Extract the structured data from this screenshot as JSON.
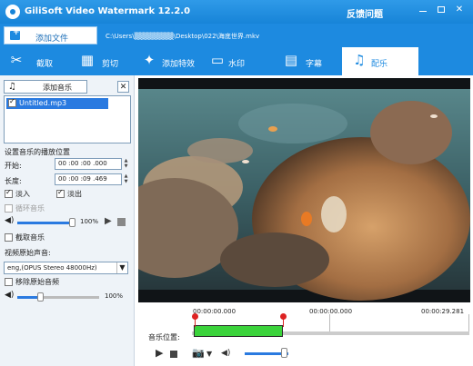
{
  "app": {
    "title": "GiliSoft Video Watermark 12.2.0",
    "feedback": "反馈问题"
  },
  "file": {
    "add_label": "添加文件",
    "path": "C:\\Users\\▒▒▒▒▒▒▒▒\\Desktop\\022\\海底世界.mkv"
  },
  "toolbar": {
    "items": [
      {
        "label": "截取",
        "icon": "scissors-icon"
      },
      {
        "label": "剪切",
        "icon": "crop-icon"
      },
      {
        "label": "添加特效",
        "icon": "magic-wand-icon"
      },
      {
        "label": "水印",
        "icon": "watermark-icon"
      },
      {
        "label": "字幕",
        "icon": "film-icon"
      },
      {
        "label": "配乐",
        "icon": "music-note-icon"
      }
    ],
    "active": "配乐"
  },
  "music": {
    "add_label": "添加音乐",
    "delete_label": "✕",
    "list": [
      {
        "name": "Untitled.mp3",
        "checked": true
      }
    ],
    "position_heading": "设置音乐的播放位置",
    "start_label": "开始:",
    "start_value": "00 :00 :00 .000",
    "duration_label": "长度:",
    "duration_value": "00 :00 :09 .469",
    "fade_in": "淡入",
    "fade_out": "淡出",
    "loop": "循环音乐",
    "trim": "截取音乐",
    "volume_pct": "100%",
    "volume_level": 1.0
  },
  "original_audio": {
    "heading": "视频原始声音:",
    "track": "eng,(OPUS Stereo 48000Hz)",
    "remove_label": "移除原始音频",
    "volume_pct": "100%",
    "volume_level": 1.0
  },
  "timeline": {
    "start": "00:00:00.000",
    "mid": "00:00:00.000",
    "end": "00:00:29.281",
    "music_label": "音乐位置:"
  },
  "colors": {
    "accent": "#1d8ae0",
    "music_bar": "#3bd33b",
    "marker": "#dd2222"
  }
}
